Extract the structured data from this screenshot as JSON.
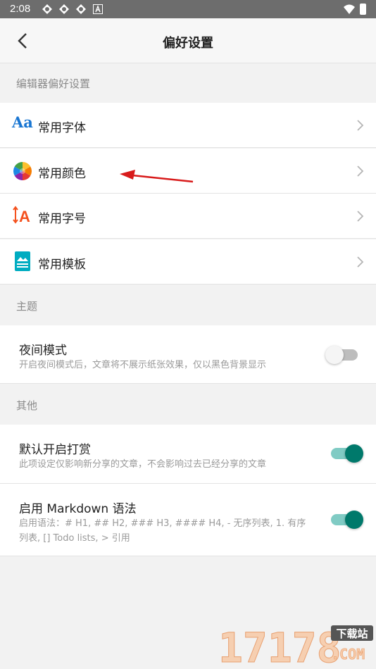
{
  "status_bar": {
    "time": "2:08",
    "icons": [
      "app-notification-icon",
      "app-notification-icon",
      "app-notification-icon",
      "a-notification-icon",
      "wifi-icon",
      "battery-icon"
    ]
  },
  "header": {
    "title": "偏好设置",
    "back_icon": "chevron-left-icon"
  },
  "sections": {
    "editor": {
      "title": "编辑器偏好设置",
      "items": [
        {
          "label": "常用字体",
          "icon": "font-icon",
          "icon_text": "Aa"
        },
        {
          "label": "常用颜色",
          "icon": "color-wheel-icon"
        },
        {
          "label": "常用字号",
          "icon": "font-size-icon",
          "icon_text": "A"
        },
        {
          "label": "常用模板",
          "icon": "template-icon"
        }
      ]
    },
    "theme": {
      "title": "主题",
      "night_mode": {
        "title": "夜间模式",
        "description": "开启夜间模式后，文章将不展示纸张效果，仅以黑色背景显示",
        "enabled": false
      }
    },
    "other": {
      "title": "其他",
      "reward": {
        "title": "默认开启打赏",
        "description": "此项设定仅影响新分享的文章，不会影响过去已经分享的文章",
        "enabled": true
      },
      "markdown": {
        "title": "启用 Markdown 语法",
        "description": "启用语法：# H1, ## H2, ### H3, #### H4, - 无序列表, 1. 有序列表, [] Todo lists, > 引用",
        "enabled": true
      }
    }
  },
  "watermark": {
    "number": "17178",
    "badge": "下载站",
    "suffix": ".COM"
  },
  "colors": {
    "accent": "#00796b",
    "accent_track": "#80cbc4",
    "arrow": "#d81b1b",
    "font_icon": "#1976d2",
    "size_icon": "#f4511e",
    "template_icon": "#00acc1"
  }
}
